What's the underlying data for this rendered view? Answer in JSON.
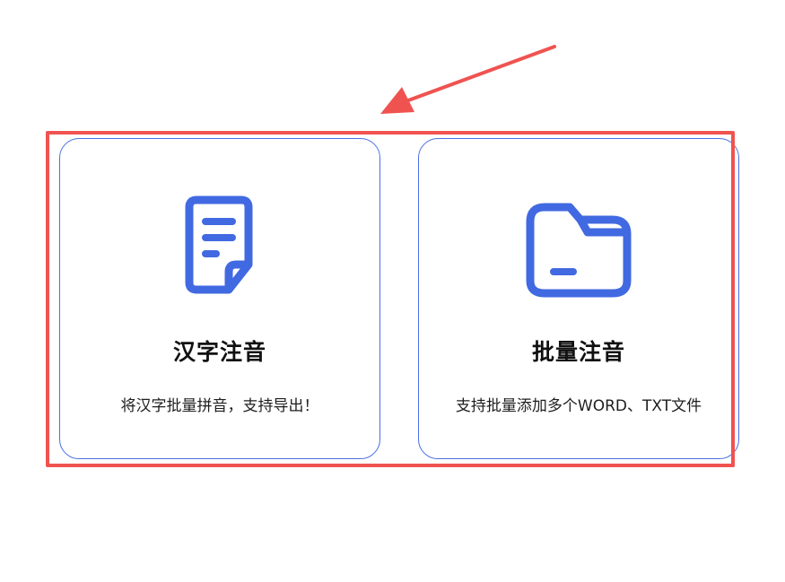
{
  "cards": [
    {
      "title": "汉字注音",
      "description": "将汉字批量拼音，支持导出！",
      "icon": "document-icon"
    },
    {
      "title": "批量注音",
      "description": "支持批量添加多个WORD、TXT文件",
      "icon": "folder-icon"
    }
  ],
  "colors": {
    "accent": "#4169e1",
    "card_border": "#4a6fe3",
    "annotation": "#ef5350"
  }
}
